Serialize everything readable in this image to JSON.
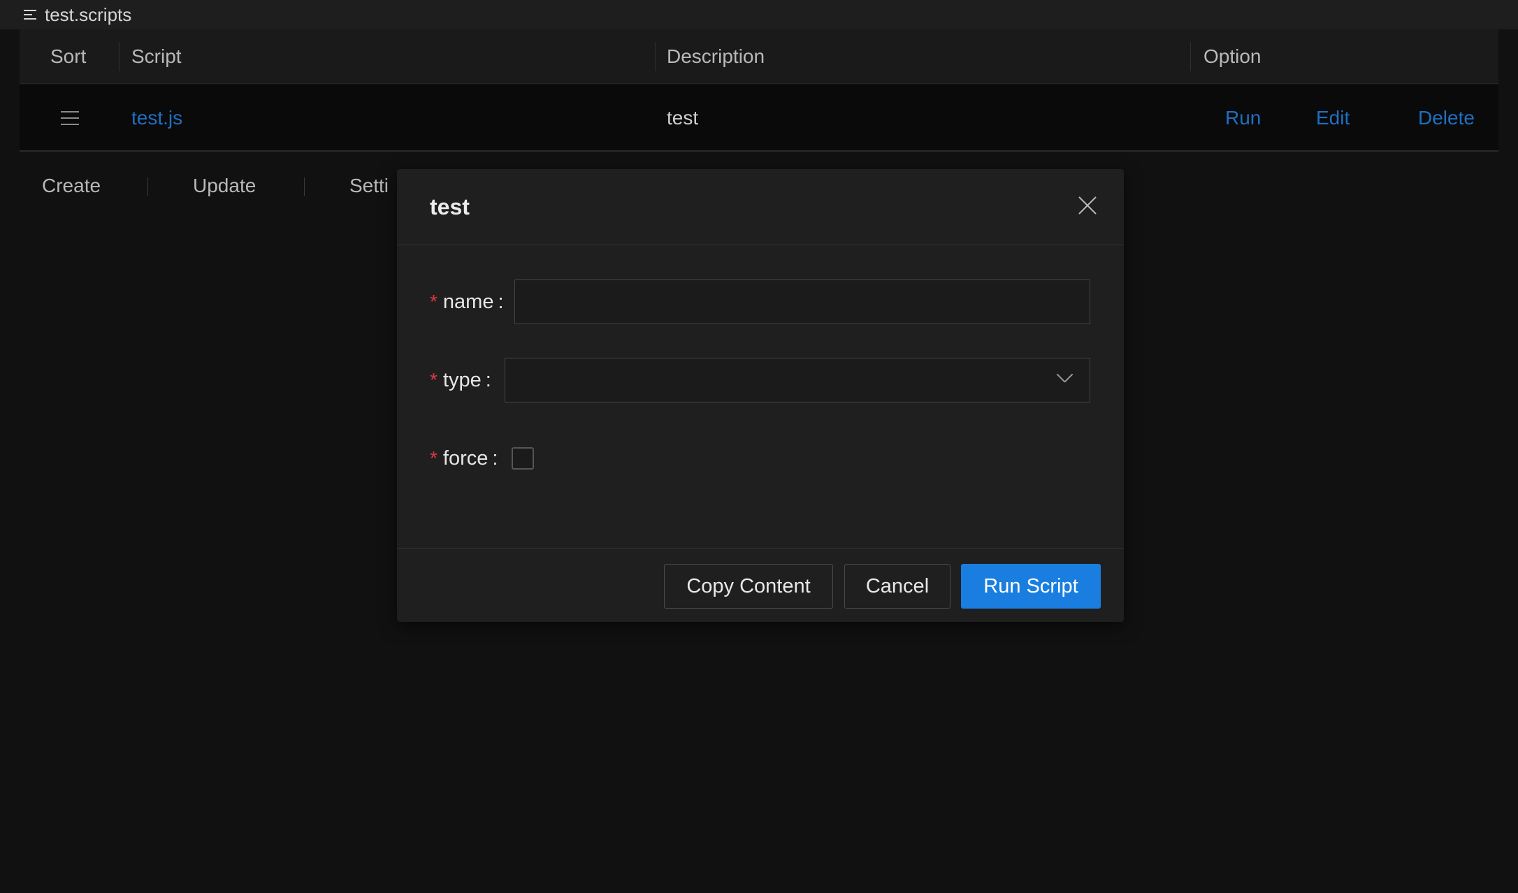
{
  "window": {
    "title": "test.scripts"
  },
  "table": {
    "headers": {
      "sort": "Sort",
      "script": "Script",
      "description": "Description",
      "option": "Option"
    },
    "rows": [
      {
        "script": "test.js",
        "description": "test",
        "actions": {
          "run": "Run",
          "edit": "Edit",
          "delete": "Delete"
        }
      }
    ]
  },
  "toolbar": {
    "create": "Create",
    "update": "Update",
    "settings": "Setti"
  },
  "dialog": {
    "title": "test",
    "fields": {
      "name": {
        "label": "name",
        "value": ""
      },
      "type": {
        "label": "type",
        "value": ""
      },
      "force": {
        "label": "force",
        "checked": false
      }
    },
    "required_mark": "*",
    "colon": ":",
    "buttons": {
      "copy": "Copy Content",
      "cancel": "Cancel",
      "run": "Run Script"
    }
  },
  "colors": {
    "primary": "#1a7ee0",
    "link": "#1f6fc4",
    "required": "#e0373f",
    "background": "#111111"
  }
}
